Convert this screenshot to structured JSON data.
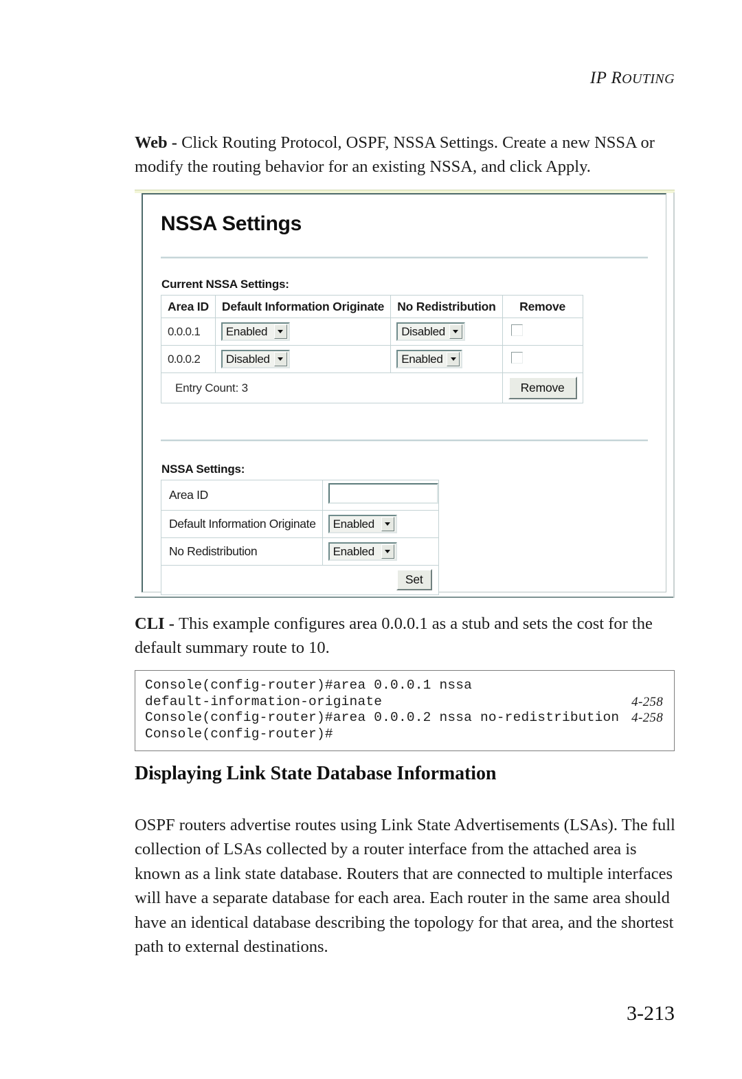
{
  "running_head": "IP ROUTING",
  "running_head_parts": {
    "lead": "IP R",
    "rest": "OUTING"
  },
  "intro": {
    "label": "Web - ",
    "text": "Click Routing Protocol, OSPF, NSSA Settings. Create a new NSSA or modify the routing behavior for an existing NSSA, and click Apply."
  },
  "screenshot": {
    "title": "NSSA Settings",
    "current": {
      "label": "Current NSSA Settings:",
      "columns": [
        "Area ID",
        "Default Information Originate",
        "No Redistribution",
        "Remove"
      ],
      "rows": [
        {
          "area_id": "0.0.0.1",
          "default_info_originate": "Enabled",
          "no_redistribution": "Disabled",
          "remove_checked": false
        },
        {
          "area_id": "0.0.0.2",
          "default_info_originate": "Disabled",
          "no_redistribution": "Enabled",
          "remove_checked": false
        }
      ],
      "entry_count_label": "Entry Count: 3",
      "remove_button": "Remove"
    },
    "form": {
      "label": "NSSA Settings:",
      "fields": [
        {
          "label": "Area ID",
          "type": "text",
          "value": "",
          "placeholder": ""
        },
        {
          "label": "Default Information Originate",
          "type": "select",
          "value": "Enabled"
        },
        {
          "label": "No Redistribution",
          "type": "select",
          "value": "Enabled"
        }
      ],
      "set_button": "Set"
    }
  },
  "cli": {
    "label": "CLI - ",
    "text": "This example configures area 0.0.0.1 as a stub and sets the cost for the default summary route to 10.",
    "lines": [
      {
        "text": "Console(config-router)#area 0.0.0.1 nssa",
        "ref": ""
      },
      {
        "text": "default-information-originate",
        "ref": "4-258"
      },
      {
        "text": "Console(config-router)#area 0.0.0.2 nssa no-redistribution",
        "ref": "4-258"
      },
      {
        "text": "Console(config-router)#",
        "ref": ""
      }
    ]
  },
  "section": {
    "heading": "Displaying Link State Database Information",
    "paragraph": "OSPF routers advertise routes using Link State Advertisements (LSAs). The full collection of LSAs collected by a router interface from the attached area is known as a link state database. Routers that are connected to multiple interfaces will have a separate database for each area. Each router in the same area should have an identical database describing the topology for that area, and the shortest path to external destinations."
  },
  "page_number": "3-213",
  "colors": {
    "frame_border": "#4e6a6a",
    "divider": "#c6d5d8",
    "table_border": "#c3d2d4",
    "widget_face": "#e9ece6"
  }
}
